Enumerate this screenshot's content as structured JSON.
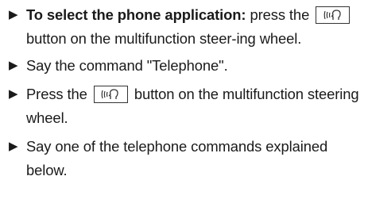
{
  "steps": [
    {
      "bold": "To select the phone application:",
      "before": " press the",
      "after": "button on the multifunction steer-ing wheel.",
      "icon": "voice-control-icon"
    },
    {
      "text": "Say the command \"Telephone\"."
    },
    {
      "before": "Press the",
      "after": "button on the multifunction steering wheel.",
      "icon": "voice-control-icon"
    },
    {
      "text": "Say one of the telephone commands explained below."
    }
  ],
  "bullet_glyph": "▶"
}
